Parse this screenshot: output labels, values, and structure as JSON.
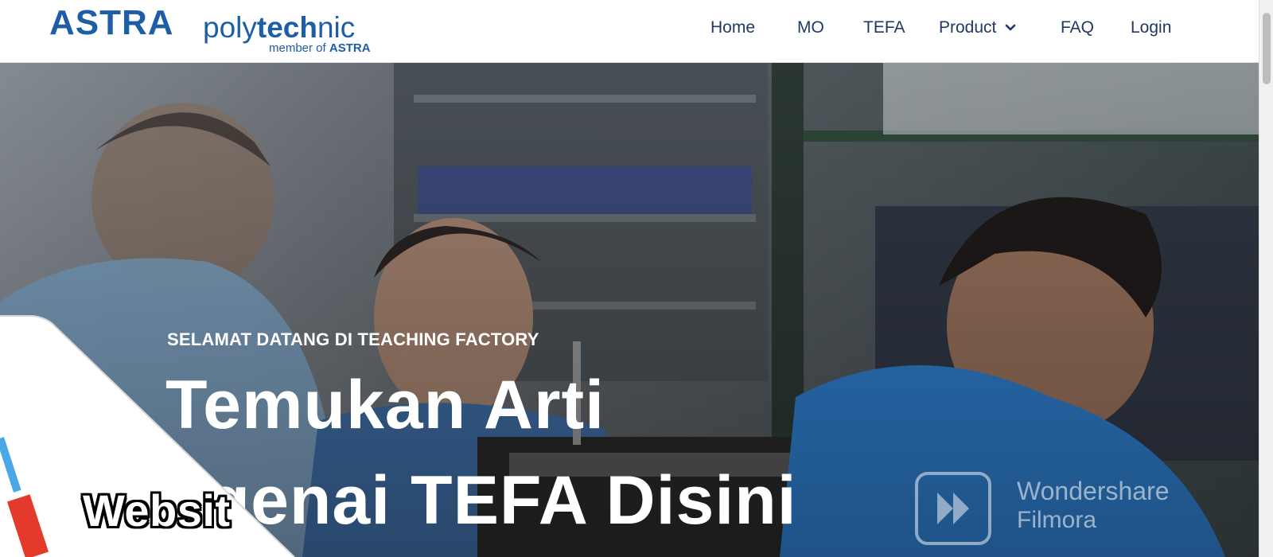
{
  "brand": {
    "name_bold": "ASTRA",
    "name_light_1": "poly",
    "name_bold_2": "tech",
    "name_light_2": "nic",
    "member_prefix": "member of",
    "member_bold": "ASTRA"
  },
  "nav": {
    "items": [
      {
        "label": "Home"
      },
      {
        "label": "MO"
      },
      {
        "label": "TEFA"
      },
      {
        "label": "Product"
      },
      {
        "label": "FAQ"
      },
      {
        "label": "Login"
      }
    ]
  },
  "hero": {
    "kicker": "SELAMAT DATANG DI TEACHING FACTORY",
    "title_line_1": "Temukan Arti",
    "title_line_2": "ngenai TEFA Disini"
  },
  "overlay": {
    "caption": "Websit",
    "watermark_line_1": "Wondershare",
    "watermark_line_2": "Filmora"
  },
  "colors": {
    "brand_blue": "#1d5ea7",
    "nav_text": "#203864",
    "uniform_blue": "#2f7fd0"
  }
}
